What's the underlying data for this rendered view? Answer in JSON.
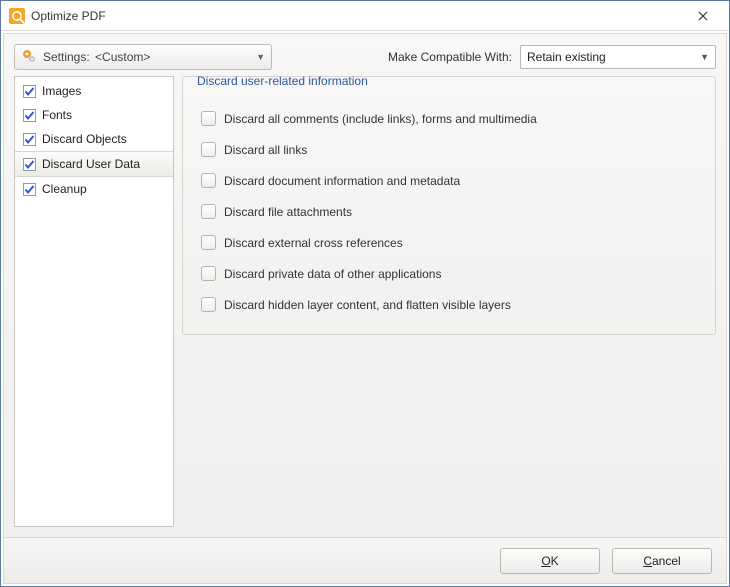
{
  "window": {
    "title": "Optimize PDF"
  },
  "settings": {
    "label": "Settings:",
    "value": "<Custom>"
  },
  "compat": {
    "label": "Make Compatible With:",
    "value": "Retain existing"
  },
  "sidebar": {
    "items": [
      {
        "label": "Images",
        "checked": true,
        "selected": false
      },
      {
        "label": "Fonts",
        "checked": true,
        "selected": false
      },
      {
        "label": "Discard Objects",
        "checked": true,
        "selected": false
      },
      {
        "label": "Discard User Data",
        "checked": true,
        "selected": true
      },
      {
        "label": "Cleanup",
        "checked": true,
        "selected": false
      }
    ]
  },
  "panel": {
    "group_title": "Discard user-related information",
    "options": [
      {
        "label": "Discard all comments (include links), forms and multimedia",
        "checked": false
      },
      {
        "label": "Discard all links",
        "checked": false
      },
      {
        "label": "Discard document information and metadata",
        "checked": false
      },
      {
        "label": "Discard file attachments",
        "checked": false
      },
      {
        "label": "Discard external cross references",
        "checked": false
      },
      {
        "label": "Discard private data of other applications",
        "checked": false
      },
      {
        "label": "Discard hidden layer content, and flatten visible layers",
        "checked": false
      }
    ]
  },
  "buttons": {
    "ok": "OK",
    "cancel": "Cancel"
  }
}
